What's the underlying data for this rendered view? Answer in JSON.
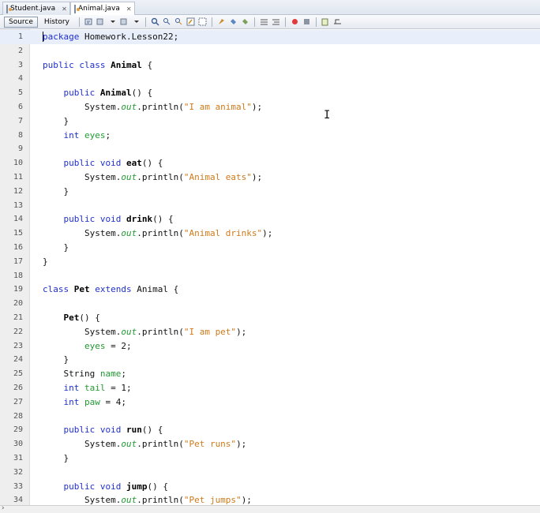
{
  "tabs": [
    {
      "label": "Student.java",
      "active": false
    },
    {
      "label": "Animal.java",
      "active": true
    }
  ],
  "toolbar": {
    "source_label": "Source",
    "history_label": "History"
  },
  "editor": {
    "lines": [
      {
        "n": "1",
        "tokens": [
          {
            "t": "package",
            "c": "kw"
          },
          {
            "t": " Homework.Lesson22;",
            "c": "pl"
          }
        ]
      },
      {
        "n": "2",
        "tokens": []
      },
      {
        "n": "3",
        "tokens": [
          {
            "t": "public class ",
            "c": "kw"
          },
          {
            "t": "Animal",
            "c": "b"
          },
          {
            "t": " {",
            "c": "pl"
          }
        ]
      },
      {
        "n": "4",
        "tokens": []
      },
      {
        "n": "5",
        "tokens": [
          {
            "t": "    public ",
            "c": "kw"
          },
          {
            "t": "Animal",
            "c": "b"
          },
          {
            "t": "() {",
            "c": "pl"
          }
        ]
      },
      {
        "n": "6",
        "tokens": [
          {
            "t": "        System.",
            "c": "pl"
          },
          {
            "t": "out",
            "c": "it"
          },
          {
            "t": ".println(",
            "c": "pl"
          },
          {
            "t": "\"I am animal\"",
            "c": "str"
          },
          {
            "t": ");",
            "c": "pl"
          }
        ]
      },
      {
        "n": "7",
        "tokens": [
          {
            "t": "    }",
            "c": "pl"
          }
        ]
      },
      {
        "n": "8",
        "tokens": [
          {
            "t": "    int ",
            "c": "kw"
          },
          {
            "t": "eyes",
            "c": "fld"
          },
          {
            "t": ";",
            "c": "pl"
          }
        ]
      },
      {
        "n": "9",
        "tokens": []
      },
      {
        "n": "10",
        "tokens": [
          {
            "t": "    public void ",
            "c": "kw"
          },
          {
            "t": "eat",
            "c": "b"
          },
          {
            "t": "() {",
            "c": "pl"
          }
        ]
      },
      {
        "n": "11",
        "tokens": [
          {
            "t": "        System.",
            "c": "pl"
          },
          {
            "t": "out",
            "c": "it"
          },
          {
            "t": ".println(",
            "c": "pl"
          },
          {
            "t": "\"Animal eats\"",
            "c": "str"
          },
          {
            "t": ");",
            "c": "pl"
          }
        ]
      },
      {
        "n": "12",
        "tokens": [
          {
            "t": "    }",
            "c": "pl"
          }
        ]
      },
      {
        "n": "13",
        "tokens": []
      },
      {
        "n": "14",
        "tokens": [
          {
            "t": "    public void ",
            "c": "kw"
          },
          {
            "t": "drink",
            "c": "b"
          },
          {
            "t": "() {",
            "c": "pl"
          }
        ]
      },
      {
        "n": "15",
        "tokens": [
          {
            "t": "        System.",
            "c": "pl"
          },
          {
            "t": "out",
            "c": "it"
          },
          {
            "t": ".println(",
            "c": "pl"
          },
          {
            "t": "\"Animal drinks\"",
            "c": "str"
          },
          {
            "t": ");",
            "c": "pl"
          }
        ]
      },
      {
        "n": "16",
        "tokens": [
          {
            "t": "    }",
            "c": "pl"
          }
        ]
      },
      {
        "n": "17",
        "tokens": [
          {
            "t": "}",
            "c": "pl"
          }
        ]
      },
      {
        "n": "18",
        "tokens": []
      },
      {
        "n": "19",
        "tokens": [
          {
            "t": "class ",
            "c": "kw"
          },
          {
            "t": "Pet",
            "c": "b"
          },
          {
            "t": " extends ",
            "c": "kw"
          },
          {
            "t": "Animal {",
            "c": "pl"
          }
        ]
      },
      {
        "n": "20",
        "tokens": []
      },
      {
        "n": "21",
        "tokens": [
          {
            "t": "    ",
            "c": "pl"
          },
          {
            "t": "Pet",
            "c": "b"
          },
          {
            "t": "() {",
            "c": "pl"
          }
        ]
      },
      {
        "n": "22",
        "tokens": [
          {
            "t": "        System.",
            "c": "pl"
          },
          {
            "t": "out",
            "c": "it"
          },
          {
            "t": ".println(",
            "c": "pl"
          },
          {
            "t": "\"I am pet\"",
            "c": "str"
          },
          {
            "t": ");",
            "c": "pl"
          }
        ]
      },
      {
        "n": "23",
        "tokens": [
          {
            "t": "        ",
            "c": "pl"
          },
          {
            "t": "eyes",
            "c": "fld"
          },
          {
            "t": " = 2;",
            "c": "pl"
          }
        ]
      },
      {
        "n": "24",
        "tokens": [
          {
            "t": "    }",
            "c": "pl"
          }
        ]
      },
      {
        "n": "25",
        "tokens": [
          {
            "t": "    String ",
            "c": "pl"
          },
          {
            "t": "name",
            "c": "fld"
          },
          {
            "t": ";",
            "c": "pl"
          }
        ]
      },
      {
        "n": "26",
        "tokens": [
          {
            "t": "    int ",
            "c": "kw"
          },
          {
            "t": "tail",
            "c": "fld"
          },
          {
            "t": " = 1;",
            "c": "pl"
          }
        ]
      },
      {
        "n": "27",
        "tokens": [
          {
            "t": "    int ",
            "c": "kw"
          },
          {
            "t": "paw",
            "c": "fld"
          },
          {
            "t": " = 4;",
            "c": "pl"
          }
        ]
      },
      {
        "n": "28",
        "tokens": []
      },
      {
        "n": "29",
        "tokens": [
          {
            "t": "    public void ",
            "c": "kw"
          },
          {
            "t": "run",
            "c": "b"
          },
          {
            "t": "() {",
            "c": "pl"
          }
        ]
      },
      {
        "n": "30",
        "tokens": [
          {
            "t": "        System.",
            "c": "pl"
          },
          {
            "t": "out",
            "c": "it"
          },
          {
            "t": ".println(",
            "c": "pl"
          },
          {
            "t": "\"Pet runs\"",
            "c": "str"
          },
          {
            "t": ");",
            "c": "pl"
          }
        ]
      },
      {
        "n": "31",
        "tokens": [
          {
            "t": "    }",
            "c": "pl"
          }
        ]
      },
      {
        "n": "32",
        "tokens": []
      },
      {
        "n": "33",
        "tokens": [
          {
            "t": "    public void ",
            "c": "kw"
          },
          {
            "t": "jump",
            "c": "b"
          },
          {
            "t": "() {",
            "c": "pl"
          }
        ]
      },
      {
        "n": "34",
        "tokens": [
          {
            "t": "        System.",
            "c": "pl"
          },
          {
            "t": "out",
            "c": "it"
          },
          {
            "t": ".println(",
            "c": "pl"
          },
          {
            "t": "\"Pet jumps\"",
            "c": "str"
          },
          {
            "t": ");",
            "c": "pl"
          }
        ]
      }
    ]
  },
  "colors": {
    "keyword": "#1f2fd1",
    "string": "#cf7a1a",
    "field": "#229933",
    "gutter": "#eeeeee",
    "current_line": "#e9effa"
  }
}
